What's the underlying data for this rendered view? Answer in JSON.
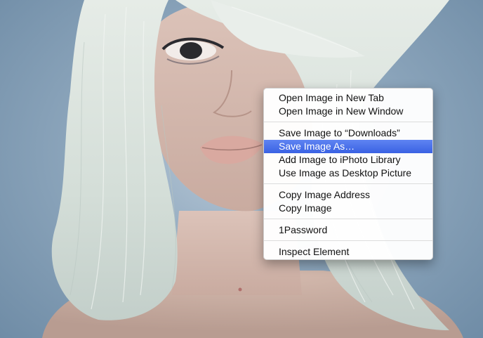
{
  "context_menu": {
    "groups": [
      {
        "items": [
          {
            "label": "Open Image in New Tab"
          },
          {
            "label": "Open Image in New Window"
          }
        ]
      },
      {
        "items": [
          {
            "label": "Save Image to “Downloads”"
          },
          {
            "label": "Save Image As…",
            "highlighted": true
          },
          {
            "label": "Add Image to iPhoto Library"
          },
          {
            "label": "Use Image as Desktop Picture"
          }
        ]
      },
      {
        "items": [
          {
            "label": "Copy Image Address"
          },
          {
            "label": "Copy Image"
          }
        ]
      },
      {
        "items": [
          {
            "label": "1Password"
          }
        ]
      },
      {
        "items": [
          {
            "label": "Inspect Element"
          }
        ]
      }
    ]
  },
  "colors": {
    "highlight": "#3d67e6",
    "background": "#7f9bb4"
  }
}
